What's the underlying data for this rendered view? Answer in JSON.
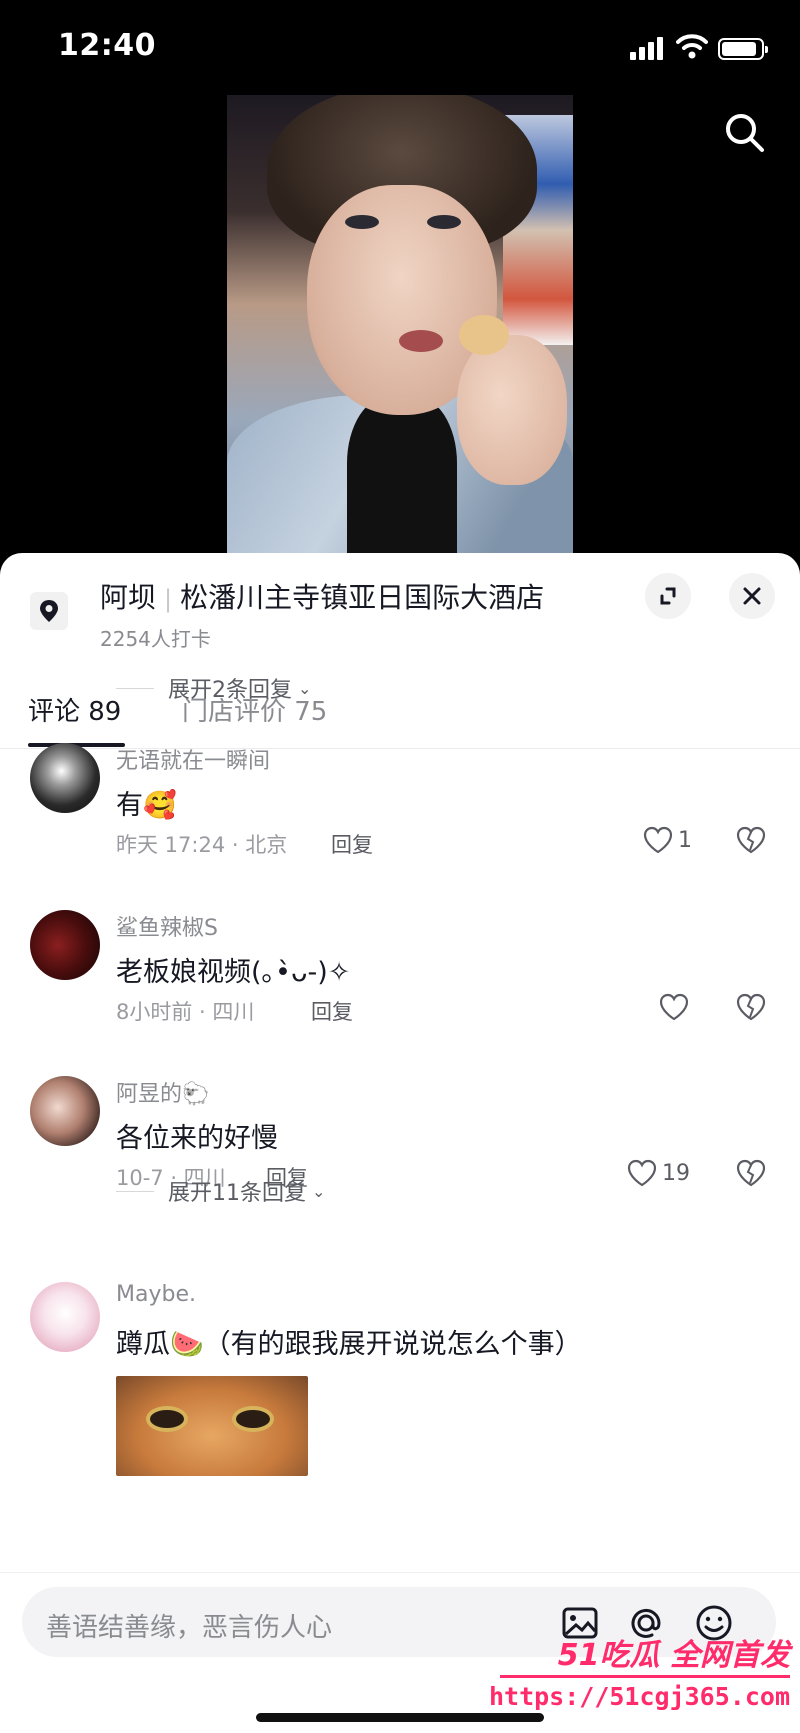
{
  "status_bar": {
    "time": "12:40"
  },
  "location": {
    "city": "阿坝",
    "separator": "|",
    "name": "松潘川主寺镇亚日国际大酒店",
    "checkins": "2254人打卡"
  },
  "tabs": [
    {
      "label": "评论 89",
      "active": true
    },
    {
      "label": "门店评价 75",
      "active": false
    }
  ],
  "replies_top": "展开2条回复",
  "comments": [
    {
      "user": "无语就在一瞬间",
      "text": "有🥰",
      "time": "昨天 17:24 · 北京",
      "reply": "回复",
      "likes": "1"
    },
    {
      "user": "鲨鱼辣椒S",
      "text": "老板娘视频(｡•̀ᴗ-)✧",
      "time": "8小时前 · 四川",
      "reply": "回复",
      "likes": ""
    },
    {
      "user": "阿昱的🐑",
      "text": "各位来的好慢",
      "time": "10-7 · 四川",
      "reply": "回复",
      "likes": "19"
    },
    {
      "user": "Maybe.",
      "text": "蹲瓜🍉（有的跟我展开说说怎么个事）",
      "time": "",
      "reply": "",
      "likes": ""
    }
  ],
  "replies_mid": "展开11条回复",
  "input": {
    "placeholder": "善语结善缘，恶言伤人心"
  },
  "watermark": {
    "brand": "51吃瓜 全网首发",
    "url": "https://51cgj365.com"
  },
  "colors": {
    "accent": "#ff2b6a",
    "text": "#161823",
    "muted": "#8a8b91"
  },
  "icons": [
    "search-icon",
    "location-pin-icon",
    "expand-icon",
    "close-icon",
    "heart-icon",
    "broken-heart-icon",
    "image-icon",
    "at-icon",
    "emoji-icon"
  ]
}
